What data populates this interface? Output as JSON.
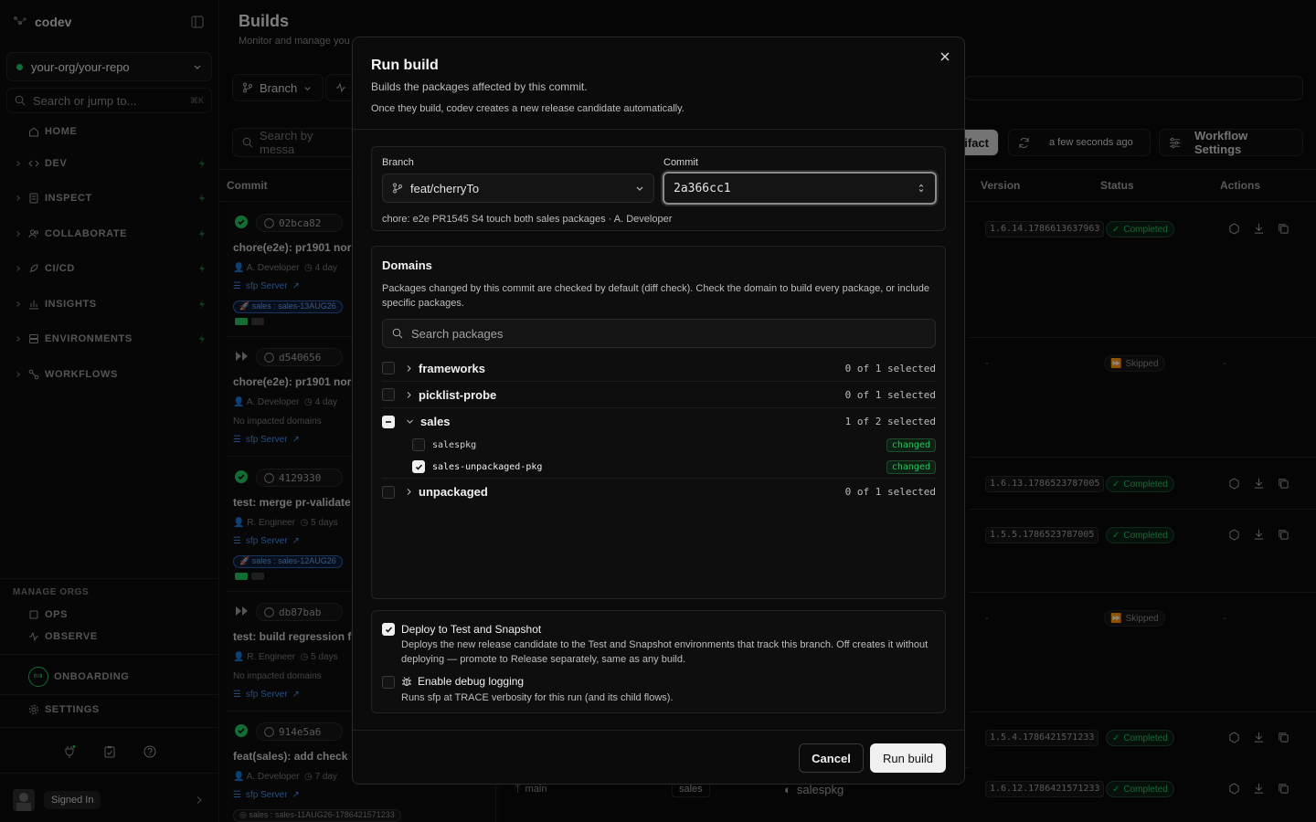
{
  "sidebar": {
    "app_name": "codev",
    "repo": "your-org/your-repo",
    "search_placeholder": "Search or jump to...",
    "search_shortcut": "⌘K",
    "nav": [
      "HOME",
      "DEV",
      "INSPECT",
      "COLLABORATE",
      "CI/CD",
      "INSIGHTS",
      "ENVIRONMENTS",
      "WORKFLOWS"
    ],
    "manage_orgs_title": "MANAGE ORGS",
    "manage_orgs": [
      "OPS",
      "OBSERVE"
    ],
    "onboarding": "ONBOARDING",
    "onboarding_progress": "0/8",
    "settings": "SETTINGS",
    "signed_in": "Signed In"
  },
  "page": {
    "title": "Builds",
    "subtitle": "Monitor and manage you",
    "branch_filter": "Branch",
    "search_placeholder": "Search by messa",
    "artifact_btn": "ifact",
    "refreshed": "a few seconds ago",
    "workflow_settings": "Workflow Settings",
    "columns": {
      "commit": "Commit",
      "version": "Version",
      "status": "Status",
      "actions": "Actions"
    }
  },
  "commits": [
    {
      "hash": "02bca82",
      "title": "chore(e2e): pr1901 nor",
      "author": "A. Developer",
      "age": "4 day",
      "server": "sfp Server",
      "tag": "sales : sales-13AUG26"
    },
    {
      "hash": "d540656",
      "title": "chore(e2e): pr1901 nor",
      "author": "A. Developer",
      "age": "4 day",
      "note": "No impacted domains",
      "server": "sfp Server"
    },
    {
      "hash": "4129330",
      "title": "test: merge pr-validate",
      "author": "R. Engineer",
      "age": "5 days",
      "server": "sfp Server",
      "tag": "sales : sales-12AUG26"
    },
    {
      "hash": "db87bab",
      "title": "test: build regression f",
      "author": "R. Engineer",
      "age": "5 days",
      "note": "No impacted domains",
      "server": "sfp Server"
    },
    {
      "hash": "914e5a6",
      "title": "feat(sales): add check",
      "author": "A. Developer",
      "age": "7 day",
      "server": "sfp Server",
      "tag": "sales : sales-11AUG26-1786421571233"
    }
  ],
  "rows": [
    {
      "version": "1.6.14.1786613637963",
      "status": "Completed"
    },
    {
      "version": "-",
      "status": "Skipped",
      "actions": "-"
    },
    {
      "version": "1.6.13.1786523787005",
      "status": "Completed"
    },
    {
      "version": "1.5.5.1786523787005",
      "status": "Completed"
    },
    {
      "version": "-",
      "status": "Skipped",
      "actions": "-"
    },
    {
      "version": "1.5.4.1786421571233",
      "status": "Completed"
    },
    {
      "version": "1.6.12.1786421571233",
      "status": "Completed"
    }
  ],
  "bottom_row": {
    "branch": "main",
    "domain": "sales",
    "package": "salespkg"
  },
  "modal": {
    "title": "Run build",
    "subtitle": "Builds the packages affected by this commit.",
    "note": "Once they build, codev creates a new release candidate automatically.",
    "branch_label": "Branch",
    "branch_value": "feat/cherryTo",
    "commit_label": "Commit",
    "commit_value": "2a366cc1",
    "commit_desc": "chore: e2e PR1545 S4 touch both sales packages · A. Developer",
    "domains_title": "Domains",
    "domains_desc": "Packages changed by this commit are checked by default (diff check). Check the domain to build every package, or include specific packages.",
    "package_search_placeholder": "Search packages",
    "domains": [
      {
        "name": "frameworks",
        "count": "0 of 1 selected"
      },
      {
        "name": "picklist-probe",
        "count": "0 of 1 selected"
      },
      {
        "name": "sales",
        "count": "1 of 2 selected",
        "packages": [
          {
            "name": "salespkg",
            "badge": "changed",
            "checked": false
          },
          {
            "name": "sales-unpackaged-pkg",
            "badge": "changed",
            "checked": true
          }
        ]
      },
      {
        "name": "unpackaged",
        "count": "0 of 1 selected"
      }
    ],
    "deploy_title": "Deploy to Test and Snapshot",
    "deploy_desc": "Deploys the new release candidate to the Test and Snapshot environments that track this branch. Off creates it without deploying — promote to Release separately, same as any build.",
    "debug_title": "Enable debug logging",
    "debug_desc": "Runs sfp at TRACE verbosity for this run (and its child flows).",
    "cancel": "Cancel",
    "run": "Run build"
  }
}
